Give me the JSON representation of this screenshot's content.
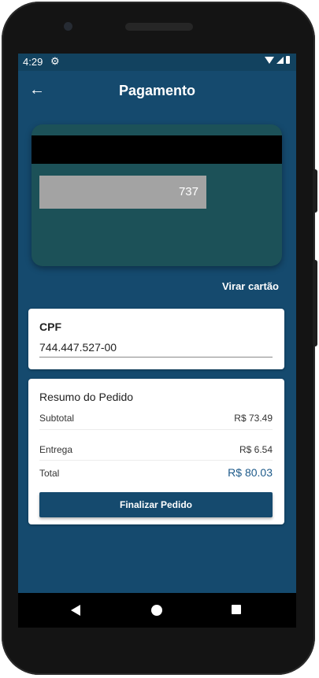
{
  "status_bar": {
    "time": "4:29"
  },
  "app_bar": {
    "title": "Pagamento"
  },
  "card": {
    "cvv": "737"
  },
  "flip_card_label": "Virar cartão",
  "cpf": {
    "label": "CPF",
    "value": "744.447.527-00"
  },
  "order_summary": {
    "title": "Resumo do Pedido",
    "rows": [
      {
        "label": "Subtotal",
        "value": "R$ 73.49"
      },
      {
        "label": "Entrega",
        "value": "R$ 6.54"
      },
      {
        "label": "Total",
        "value": "R$ 80.03"
      }
    ],
    "button_label": "Finalizar Pedido"
  },
  "colors": {
    "primary": "#154a6e",
    "card_background": "#1c5158",
    "total_accent": "#1d5a8a"
  }
}
